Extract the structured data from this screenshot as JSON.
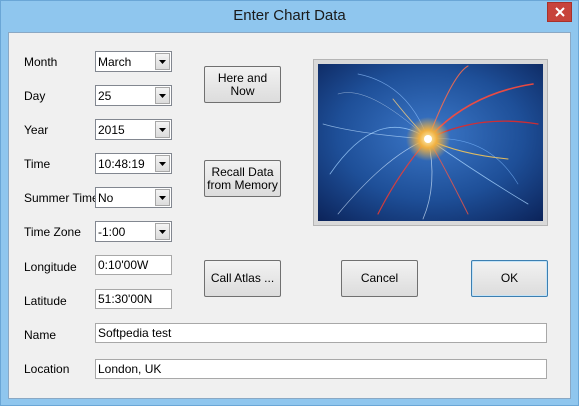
{
  "window": {
    "title": "Enter Chart Data"
  },
  "fields": {
    "month": {
      "label": "Month",
      "value": "March"
    },
    "day": {
      "label": "Day",
      "value": "25"
    },
    "year": {
      "label": "Year",
      "value": "2015"
    },
    "time": {
      "label": "Time",
      "value": "10:48:19"
    },
    "summer_time": {
      "label": "Summer Time",
      "value": "No"
    },
    "time_zone": {
      "label": "Time Zone",
      "value": "-1:00"
    },
    "longitude": {
      "label": "Longitude",
      "value": "0:10'00W"
    },
    "latitude": {
      "label": "Latitude",
      "value": "51:30'00N"
    },
    "name": {
      "label": "Name",
      "value": "Softpedia test"
    },
    "location": {
      "label": "Location",
      "value": "London, UK"
    }
  },
  "buttons": {
    "here_and_now": "Here and\nNow",
    "recall_data": "Recall Data\nfrom Memory",
    "call_atlas": "Call Atlas ...",
    "cancel": "Cancel",
    "ok": "OK"
  },
  "icons": {
    "close": "close-icon",
    "dropdown": "chevron-down-icon"
  },
  "colors": {
    "titlebar": "#8fc6ee",
    "close_button": "#c7433b",
    "dialog_background": "#f0f0f0"
  }
}
